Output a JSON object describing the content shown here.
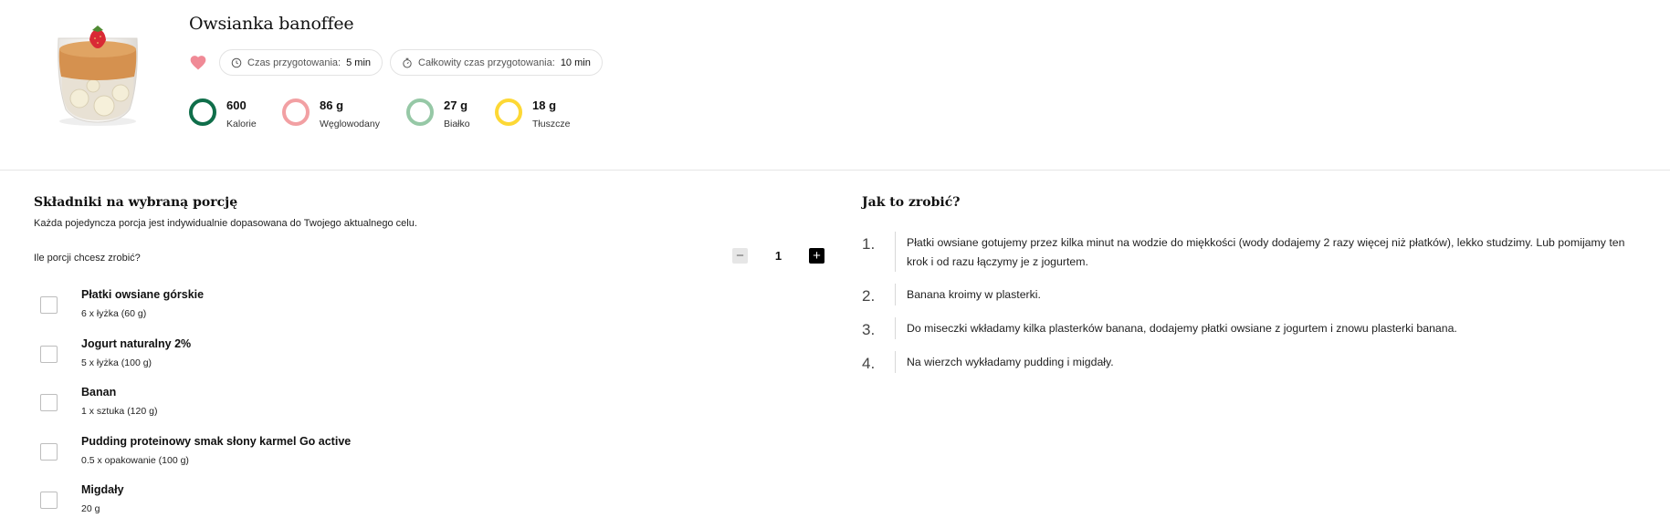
{
  "recipe": {
    "title": "Owsianka banoffee",
    "favorite": true,
    "prep_label": "Czas przygotowania:",
    "prep_value": "5 min",
    "total_label": "Całkowity czas przygotowania:",
    "total_value": "10 min"
  },
  "macros": [
    {
      "value": "600",
      "label": "Kalorie",
      "color": "#0f6e4a"
    },
    {
      "value": "86 g",
      "label": "Węglowodany",
      "color": "#f2a0a3"
    },
    {
      "value": "27 g",
      "label": "Białko",
      "color": "#96c8a6"
    },
    {
      "value": "18 g",
      "label": "Tłuszcze",
      "color": "#fdd835"
    }
  ],
  "ingredients": {
    "title": "Składniki na wybraną porcję",
    "subtitle": "Każda pojedyncza porcja jest indywidualnie dopasowana do Twojego aktualnego celu.",
    "portion_question": "Ile porcji chcesz zrobić?",
    "portions": "1",
    "minus_symbol": "−",
    "plus_symbol": "+",
    "items": [
      {
        "name": "Płatki owsiane górskie",
        "qty": "6 x łyżka (60 g)",
        "checked": false
      },
      {
        "name": "Jogurt naturalny 2%",
        "qty": "5 x łyżka (100 g)",
        "checked": false
      },
      {
        "name": "Banan",
        "qty": "1 x sztuka (120 g)",
        "checked": false
      },
      {
        "name": "Pudding proteinowy smak słony karmel Go active",
        "qty": "0.5 x opakowanie (100 g)",
        "checked": false
      },
      {
        "name": "Migdały",
        "qty": "20 g",
        "checked": false
      }
    ]
  },
  "steps": {
    "title": "Jak to zrobić?",
    "items": [
      {
        "num": "1.",
        "text": "Płatki owsiane gotujemy przez kilka minut na wodzie do miękkości (wody dodajemy 2 razy więcej niż płatków), lekko studzimy. Lub pomijamy ten krok i od razu łączymy je z jogurtem."
      },
      {
        "num": "2.",
        "text": "Banana kroimy w plasterki."
      },
      {
        "num": "3.",
        "text": "Do miseczki wkładamy kilka plasterków banana, dodajemy płatki owsiane z jogurtem i znowu plasterki banana."
      },
      {
        "num": "4.",
        "text": "Na wierzch wykładamy pudding i migdały."
      }
    ]
  },
  "colors": {
    "heart": "#f08a96",
    "accent": "#0f6e4a"
  }
}
